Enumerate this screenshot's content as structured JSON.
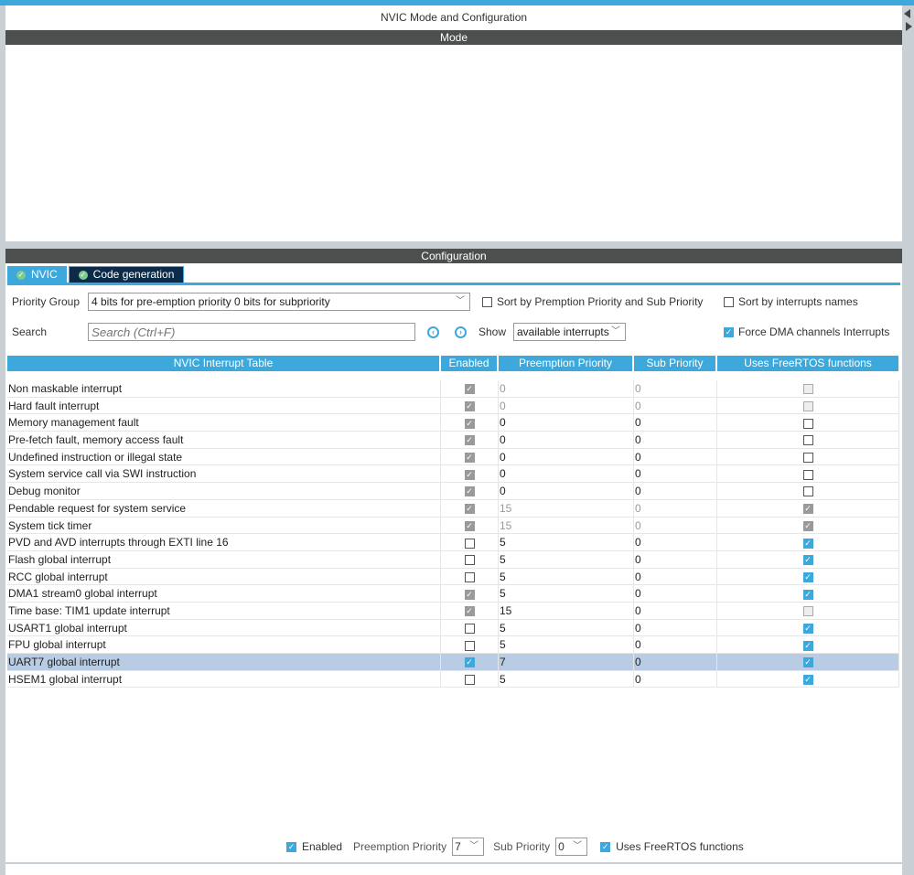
{
  "window": {
    "title": "NVIC Mode and Configuration",
    "mode_header": "Mode",
    "config_header": "Configuration"
  },
  "tabs": [
    {
      "label": "NVIC"
    },
    {
      "label": "Code generation"
    }
  ],
  "controls": {
    "priority_group_label": "Priority Group",
    "priority_group_value": "4 bits for pre-emption priority 0 bits for subpriority",
    "sort_premption_label": "Sort by Premption Priority and Sub Priority",
    "sort_premption_checked": false,
    "sort_names_label": "Sort by interrupts names",
    "sort_names_checked": false,
    "search_label": "Search",
    "search_placeholder": "Search (Ctrl+F)",
    "show_label": "Show",
    "show_value": "available interrupts",
    "force_dma_label": "Force DMA channels Interrupts",
    "force_dma_checked": true
  },
  "table": {
    "headers": [
      "NVIC Interrupt Table",
      "Enabled",
      "Preemption Priority",
      "Sub Priority",
      "Uses FreeRTOS functions"
    ],
    "rows": [
      {
        "name": "Non maskable interrupt",
        "enabled": "dchecked",
        "pre": "0",
        "sub": "0",
        "dim": true,
        "rtos": "dunchecked"
      },
      {
        "name": "Hard fault interrupt",
        "enabled": "dchecked",
        "pre": "0",
        "sub": "0",
        "dim": true,
        "rtos": "dunchecked"
      },
      {
        "name": "Memory management fault",
        "enabled": "dchecked",
        "pre": "0",
        "sub": "0",
        "dim": false,
        "rtos": "unchecked"
      },
      {
        "name": "Pre-fetch fault, memory access fault",
        "enabled": "dchecked",
        "pre": "0",
        "sub": "0",
        "dim": false,
        "rtos": "unchecked"
      },
      {
        "name": "Undefined instruction or illegal state",
        "enabled": "dchecked",
        "pre": "0",
        "sub": "0",
        "dim": false,
        "rtos": "unchecked"
      },
      {
        "name": "System service call via SWI instruction",
        "enabled": "dchecked",
        "pre": "0",
        "sub": "0",
        "dim": false,
        "rtos": "unchecked"
      },
      {
        "name": "Debug monitor",
        "enabled": "dchecked",
        "pre": "0",
        "sub": "0",
        "dim": false,
        "rtos": "unchecked"
      },
      {
        "name": "Pendable request for system service",
        "enabled": "dchecked",
        "pre": "15",
        "sub": "0",
        "dim": true,
        "rtos": "dchecked"
      },
      {
        "name": "System tick timer",
        "enabled": "dchecked",
        "pre": "15",
        "sub": "0",
        "dim": true,
        "rtos": "dchecked"
      },
      {
        "name": "PVD and AVD interrupts through EXTI line 16",
        "enabled": "unchecked",
        "pre": "5",
        "sub": "0",
        "dim": false,
        "rtos": "checked"
      },
      {
        "name": "Flash global interrupt",
        "enabled": "unchecked",
        "pre": "5",
        "sub": "0",
        "dim": false,
        "rtos": "checked"
      },
      {
        "name": "RCC global interrupt",
        "enabled": "unchecked",
        "pre": "5",
        "sub": "0",
        "dim": false,
        "rtos": "checked"
      },
      {
        "name": "DMA1 stream0 global interrupt",
        "enabled": "dchecked",
        "pre": "5",
        "sub": "0",
        "dim": false,
        "rtos": "checked"
      },
      {
        "name": "Time base: TIM1 update interrupt",
        "enabled": "dchecked",
        "pre": "15",
        "sub": "0",
        "dim": false,
        "rtos": "dunchecked"
      },
      {
        "name": "USART1 global interrupt",
        "enabled": "unchecked",
        "pre": "5",
        "sub": "0",
        "dim": false,
        "rtos": "checked"
      },
      {
        "name": "FPU global interrupt",
        "enabled": "unchecked",
        "pre": "5",
        "sub": "0",
        "dim": false,
        "rtos": "checked"
      },
      {
        "name": "UART7 global interrupt",
        "enabled": "checked",
        "pre": "7",
        "sub": "0",
        "dim": false,
        "rtos": "checked",
        "selected": true
      },
      {
        "name": "HSEM1 global interrupt",
        "enabled": "unchecked",
        "pre": "5",
        "sub": "0",
        "dim": false,
        "rtos": "checked"
      }
    ]
  },
  "bottom": {
    "enabled_label": "Enabled",
    "enabled_checked": true,
    "preemption_label": "Preemption Priority",
    "preemption_value": "7",
    "sub_label": "Sub Priority",
    "sub_value": "0",
    "rtos_label": "Uses FreeRTOS functions",
    "rtos_checked": true
  },
  "colors": {
    "accent": "#3ca8dc",
    "header_dark": "#4d4f4e",
    "selected_row": "#b8cde3"
  }
}
